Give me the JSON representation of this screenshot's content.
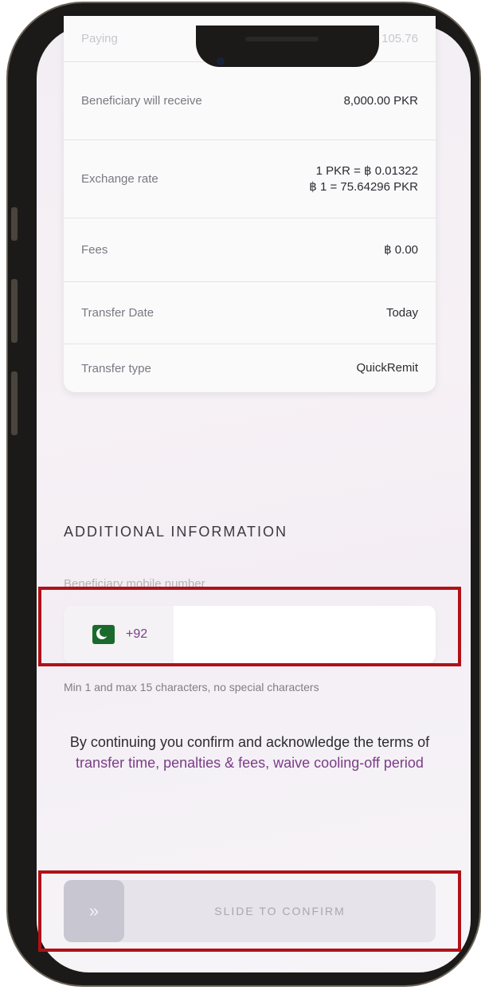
{
  "summary_rows": [
    {
      "label": "Paying",
      "value": "฿ 105.76"
    },
    {
      "label": "Beneficiary will receive",
      "value": "8,000.00 PKR"
    },
    {
      "label": "Exchange rate",
      "value": "1 PKR = ฿ 0.01322",
      "value2": "฿ 1 = 75.64296 PKR"
    },
    {
      "label": "Fees",
      "value": "฿ 0.00"
    },
    {
      "label": "Transfer Date",
      "value": "Today"
    },
    {
      "label": "Transfer type",
      "value": "QuickRemit"
    }
  ],
  "additional": {
    "section_title": "ADDITIONAL INFORMATION",
    "mobile_label": "Beneficiary mobile number",
    "country_code": "+92",
    "country_flag_icon": "pakistan-flag-icon",
    "mobile_value": "",
    "helper_text": "Min 1 and max 15 characters, no special characters"
  },
  "terms": {
    "prefix": "By continuing you confirm and acknowledge the terms of ",
    "link_text": "transfer time, penalties & fees, waive cooling-off period"
  },
  "slider": {
    "knob_symbol": "»",
    "label": "SLIDE TO CONFIRM"
  },
  "colors": {
    "accent": "#7a3d86",
    "highlight": "#b01118"
  }
}
